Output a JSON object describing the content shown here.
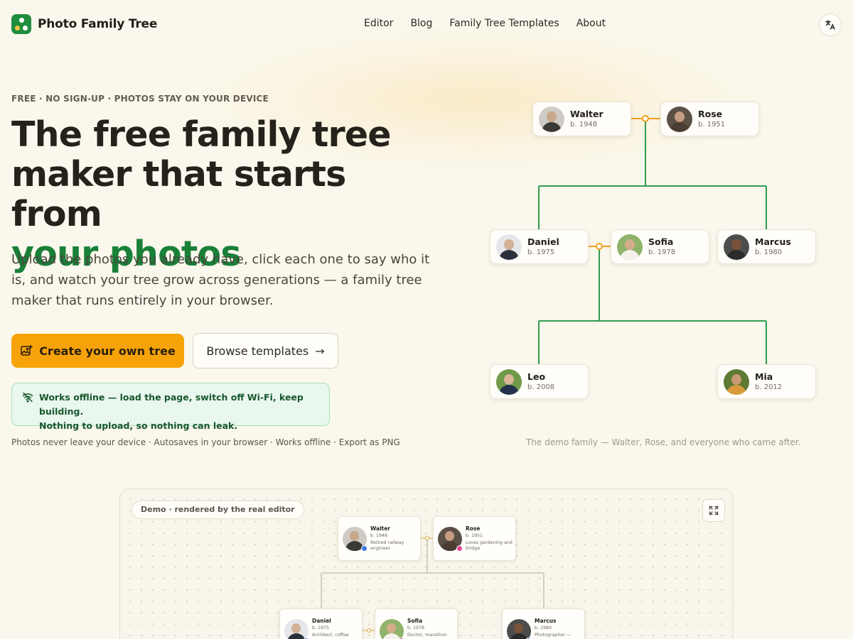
{
  "header": {
    "brand": "Photo Family Tree",
    "nav": [
      "Editor",
      "Blog",
      "Family Tree Templates",
      "About"
    ],
    "language_icon": "translate-icon"
  },
  "hero": {
    "eyebrow": "FREE · NO SIGN-UP · PHOTOS STAY ON YOUR DEVICE",
    "title_line1": "The free family tree",
    "title_line2": "maker that starts from",
    "title_highlight": "your photos",
    "subtitle": "Upload the photos you already have, click each one to say who it is, and watch your tree grow across generations — a family tree maker that runs entirely in your browser.",
    "primary_cta": "Create your own tree",
    "secondary_cta": "Browse templates",
    "secondary_cta_arrow": "→",
    "offline_line1": "Works offline — load the page, switch off Wi-Fi, keep building.",
    "offline_line2": "Nothing to upload, so nothing can leak.",
    "features": "Photos never leave your device · Autosaves in your browser · Works offline · Export as PNG",
    "tree_caption": "The demo family — Walter, Rose, and everyone who came after."
  },
  "hero_tree": {
    "people": [
      {
        "name": "Walter",
        "born": "b. 1948"
      },
      {
        "name": "Rose",
        "born": "b. 1951"
      },
      {
        "name": "Daniel",
        "born": "b. 1975"
      },
      {
        "name": "Sofia",
        "born": "b. 1978"
      },
      {
        "name": "Marcus",
        "born": "b. 1980"
      },
      {
        "name": "Leo",
        "born": "b. 2008"
      },
      {
        "name": "Mia",
        "born": "b. 2012"
      }
    ]
  },
  "demo": {
    "tag": "Demo · rendered by the real editor",
    "expand_icon": "expand-icon",
    "people": [
      {
        "name": "Walter",
        "born": "b. 1948",
        "note": "Retired railway engineer"
      },
      {
        "name": "Rose",
        "born": "b. 1951",
        "note": "Loves gardening and bridge"
      },
      {
        "name": "Daniel",
        "born": "b. 1975",
        "note": "Architect, coffee"
      },
      {
        "name": "Sofia",
        "born": "b. 1978",
        "note": "Doctor, marathon"
      },
      {
        "name": "Marcus",
        "born": "b. 1980",
        "note": "Photographer —"
      }
    ]
  },
  "colors": {
    "accent_green": "#198038",
    "cta_orange": "#f6a30a",
    "tree_line_green": "#2f9e4f",
    "spouse_line_orange": "#f0a020",
    "background": "#faf7ec"
  }
}
